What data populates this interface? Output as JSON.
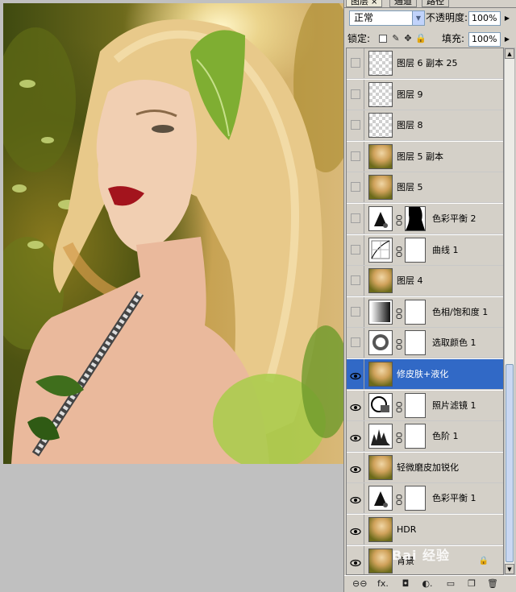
{
  "panel": {
    "tabs": [
      {
        "label": "图层",
        "close": "×"
      },
      {
        "label": "通道"
      },
      {
        "label": "路径"
      }
    ],
    "blend_mode": "正常",
    "opacity_label": "不透明度:",
    "opacity_value": "100%",
    "lock_label": "锁定:",
    "fill_label": "填充:",
    "fill_value": "100%"
  },
  "layers": [
    {
      "name": "图层 6 副本 25",
      "visible": false,
      "thumb": "transparent"
    },
    {
      "name": "图层 9",
      "visible": false,
      "thumb": "transparent"
    },
    {
      "name": "图层 8",
      "visible": false,
      "thumb": "transparent"
    },
    {
      "name": "图层 5 副本",
      "visible": false,
      "thumb": "photo"
    },
    {
      "name": "图层 5",
      "visible": false,
      "thumb": "photo"
    },
    {
      "name": "色彩平衡 2",
      "visible": false,
      "thumb": "adj-balance",
      "mask": "silhouette"
    },
    {
      "name": "曲线 1",
      "visible": false,
      "thumb": "adj-curves",
      "mask": "white"
    },
    {
      "name": "图层 4",
      "visible": false,
      "thumb": "photo"
    },
    {
      "name": "色相/饱和度 1",
      "visible": false,
      "thumb": "adj-hue",
      "mask": "white"
    },
    {
      "name": "选取颜色 1",
      "visible": false,
      "thumb": "adj-selective",
      "mask": "white"
    },
    {
      "name": "修皮肤+液化",
      "visible": true,
      "thumb": "photo",
      "selected": true
    },
    {
      "name": "照片滤镜 1",
      "visible": true,
      "thumb": "adj-photofilter",
      "mask": "white"
    },
    {
      "name": "色阶 1",
      "visible": true,
      "thumb": "adj-levels",
      "mask": "white"
    },
    {
      "name": "轻微磨皮加锐化",
      "visible": true,
      "thumb": "photo"
    },
    {
      "name": "色彩平衡 1",
      "visible": true,
      "thumb": "adj-balance",
      "mask": "white"
    },
    {
      "name": "HDR",
      "visible": true,
      "thumb": "photo"
    },
    {
      "name": "背景",
      "visible": true,
      "thumb": "photo",
      "locked": true
    }
  ],
  "bottom_icons": [
    "link-icon",
    "fx-icon",
    "mask-icon",
    "adjustment-icon",
    "group-folder-icon",
    "new-layer-icon",
    "trash-icon"
  ],
  "bottom_labels": {
    "link": "⊖⊖",
    "fx": "fx.",
    "mask": "◘",
    "adjust": "◐.",
    "folder": "▭",
    "new": "❐",
    "trash": "🗑"
  },
  "watermark": "Bai 经验"
}
